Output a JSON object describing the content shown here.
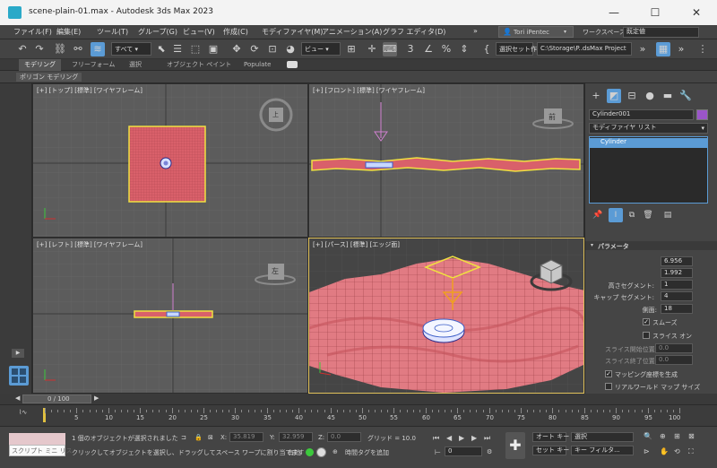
{
  "window": {
    "title": "scene-plain-01.max - Autodesk 3ds Max 2023",
    "minimize": "—",
    "maximize": "☐",
    "close": "✕"
  },
  "menu": {
    "items": [
      "ファイル(F)",
      "編集(E)",
      "ツール(T)",
      "グループ(G)",
      "ビュー(V)",
      "作成(C)",
      "モディファイヤ(M)",
      "アニメーション(A)",
      "グラフ エディタ(D)"
    ],
    "more": "»",
    "user": "Tori iPentec",
    "workspace_label": "ワークスペース:",
    "workspace_value": "既定値"
  },
  "toolbar": {
    "filter": "すべて",
    "refcoord": "ビュー",
    "named_selection": "選択セット作",
    "project_path": "C:\\Storage\\P..dsMax Project"
  },
  "ribbon": {
    "tabs": [
      "モデリング",
      "フリーフォーム",
      "選択",
      "オブジェクト ペイント",
      "Populate"
    ],
    "sub": "ポリゴン モデリング"
  },
  "viewports": {
    "top": "[+] [トップ] [標準] [ワイヤフレーム]",
    "front": "[+] [フロント] [標準] [ワイヤフレーム]",
    "left": "[+] [レフト] [標準] [ワイヤフレーム]",
    "persp": "[+] [パース] [標準] [エッジ面]",
    "cube_top": "上",
    "cube_front": "前",
    "cube_left": "左"
  },
  "command_panel": {
    "object_name": "Cylinder001",
    "object_color": "#9b55c9",
    "modifier_list": "モディファイヤ リスト",
    "stack": [
      "Cylinder"
    ],
    "rollout": "パラメータ",
    "params": [
      {
        "label": "半径:",
        "value": "6.956"
      },
      {
        "label": "高さ:",
        "value": "1.992"
      },
      {
        "label": "高さセグメント:",
        "value": "1"
      },
      {
        "label": "キャップ セグメント:",
        "value": "4"
      },
      {
        "label": "側面:",
        "value": "18"
      }
    ],
    "smooth": "スムーズ",
    "slice_on": "スライス オン",
    "slice_from_label": "スライス開始位置:",
    "slice_from": "0.0",
    "slice_to_label": "スライス終了位置:",
    "slice_to": "0.0",
    "gen_mapping": "マッピング座標を生成",
    "real_world": "リアルワールド マップ サイズ"
  },
  "timeline": {
    "frame": "0 / 100",
    "ticks": [
      "5",
      "10",
      "15",
      "20",
      "25",
      "30",
      "35",
      "40",
      "45",
      "50",
      "55",
      "60",
      "65",
      "70",
      "75",
      "80",
      "85",
      "90",
      "95",
      "100"
    ]
  },
  "status": {
    "maxscript": "スクリプト ミニ リス",
    "selected": "1 個のオブジェクトが選択されました",
    "prompt": "クリックしてオブジェクトを選択し、ドラッグしてスペース ワープに割り当てます",
    "x_label": "X:",
    "x": "35.819",
    "y_label": "Y:",
    "y": "32.959",
    "z_label": "Z:",
    "z": "0.0",
    "grid": "グリッド = 10.0",
    "enabled": "有効:",
    "add_tag": "時間タグを追加",
    "autokey": "オート キー",
    "setkey": "セット キー",
    "selection": "選択",
    "keyfilter": "キー フィルタ...",
    "frame_value": "0"
  },
  "colors": {
    "accent": "#5b9bd5",
    "terrain": "#d9606a",
    "selection": "#f0e040"
  }
}
